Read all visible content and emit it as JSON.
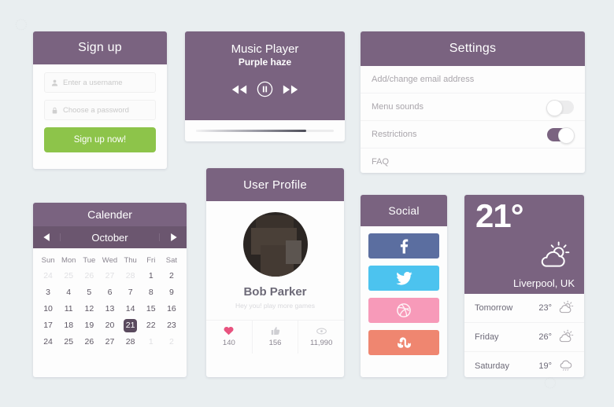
{
  "theme": {
    "purple": "#7a6380",
    "purple_dark": "#6b566f",
    "today_purple": "#5a4a5e",
    "green": "#8dc44a",
    "background": "#e9eef0"
  },
  "signup": {
    "title": "Sign up",
    "username_placeholder": "Enter a username",
    "password_placeholder": "Choose a password",
    "username_icon": "person-icon",
    "password_icon": "lock-icon",
    "button_label": "Sign up now!"
  },
  "music": {
    "title": "Music Player",
    "subtitle": "Purple haze",
    "controls": [
      {
        "name": "rewind-button",
        "icon": "rewind-icon"
      },
      {
        "name": "pause-button",
        "icon": "pause-circle-icon"
      },
      {
        "name": "forward-button",
        "icon": "fast-forward-icon"
      }
    ],
    "progress_percent": 80
  },
  "settings": {
    "title": "Settings",
    "rows": [
      {
        "label": "Add/change email address",
        "toggle": null
      },
      {
        "label": "Menu sounds",
        "toggle": "off"
      },
      {
        "label": "Restrictions",
        "toggle": "on"
      },
      {
        "label": "FAQ",
        "toggle": null
      }
    ]
  },
  "calendar": {
    "title": "Calender",
    "month": "October",
    "prev_icon": "triangle-left-icon",
    "next_icon": "triangle-right-icon",
    "weekdays": [
      "Sun",
      "Mon",
      "Tue",
      "Wed",
      "Thu",
      "Fri",
      "Sat"
    ],
    "today": 21,
    "weeks": [
      [
        {
          "d": "24",
          "muted": true
        },
        {
          "d": "25",
          "muted": true
        },
        {
          "d": "26",
          "muted": true
        },
        {
          "d": "27",
          "muted": true
        },
        {
          "d": "28",
          "muted": true
        },
        {
          "d": "1"
        },
        {
          "d": "2"
        }
      ],
      [
        {
          "d": "3"
        },
        {
          "d": "4"
        },
        {
          "d": "5"
        },
        {
          "d": "6"
        },
        {
          "d": "7"
        },
        {
          "d": "8"
        },
        {
          "d": "9"
        }
      ],
      [
        {
          "d": "10"
        },
        {
          "d": "11"
        },
        {
          "d": "12"
        },
        {
          "d": "13"
        },
        {
          "d": "14"
        },
        {
          "d": "15"
        },
        {
          "d": "16"
        }
      ],
      [
        {
          "d": "17"
        },
        {
          "d": "18"
        },
        {
          "d": "19"
        },
        {
          "d": "20"
        },
        {
          "d": "21",
          "today": true
        },
        {
          "d": "22"
        },
        {
          "d": "23"
        }
      ],
      [
        {
          "d": "24"
        },
        {
          "d": "25"
        },
        {
          "d": "26"
        },
        {
          "d": "27"
        },
        {
          "d": "28"
        },
        {
          "d": "1",
          "muted": true
        },
        {
          "d": "2",
          "muted": true
        }
      ]
    ]
  },
  "profile": {
    "title": "User Profile",
    "name": "Bob Parker",
    "tagline": "Hey you! play more games",
    "avatar_alt": "user-avatar",
    "stats": [
      {
        "icon": "heart-icon",
        "value": "140"
      },
      {
        "icon": "thumbs-up-icon",
        "value": "156"
      },
      {
        "icon": "eye-icon",
        "value": "11,990"
      }
    ]
  },
  "social": {
    "title": "Social",
    "buttons": [
      {
        "name": "facebook",
        "glyph": "f",
        "color": "#5b6ea0"
      },
      {
        "name": "twitter",
        "glyph": "twitter-icon",
        "color": "#4cc3ef"
      },
      {
        "name": "dribbble",
        "glyph": "dribbble-icon",
        "color": "#f79ab9"
      },
      {
        "name": "stumbleupon",
        "glyph": "stumbleupon-icon",
        "color": "#ef8670"
      }
    ]
  },
  "weather": {
    "temperature": "21",
    "degree": "°",
    "location": "Liverpool, UK",
    "current_icon": "sun-behind-cloud-icon",
    "forecast": [
      {
        "day": "Tomorrow",
        "temp": "23",
        "degree": "°",
        "icon": "sun-behind-cloud-icon"
      },
      {
        "day": "Friday",
        "temp": "26",
        "degree": "°",
        "icon": "sun-behind-cloud-icon"
      },
      {
        "day": "Saturday",
        "temp": "19",
        "degree": "°",
        "icon": "rain-cloud-icon"
      }
    ]
  }
}
